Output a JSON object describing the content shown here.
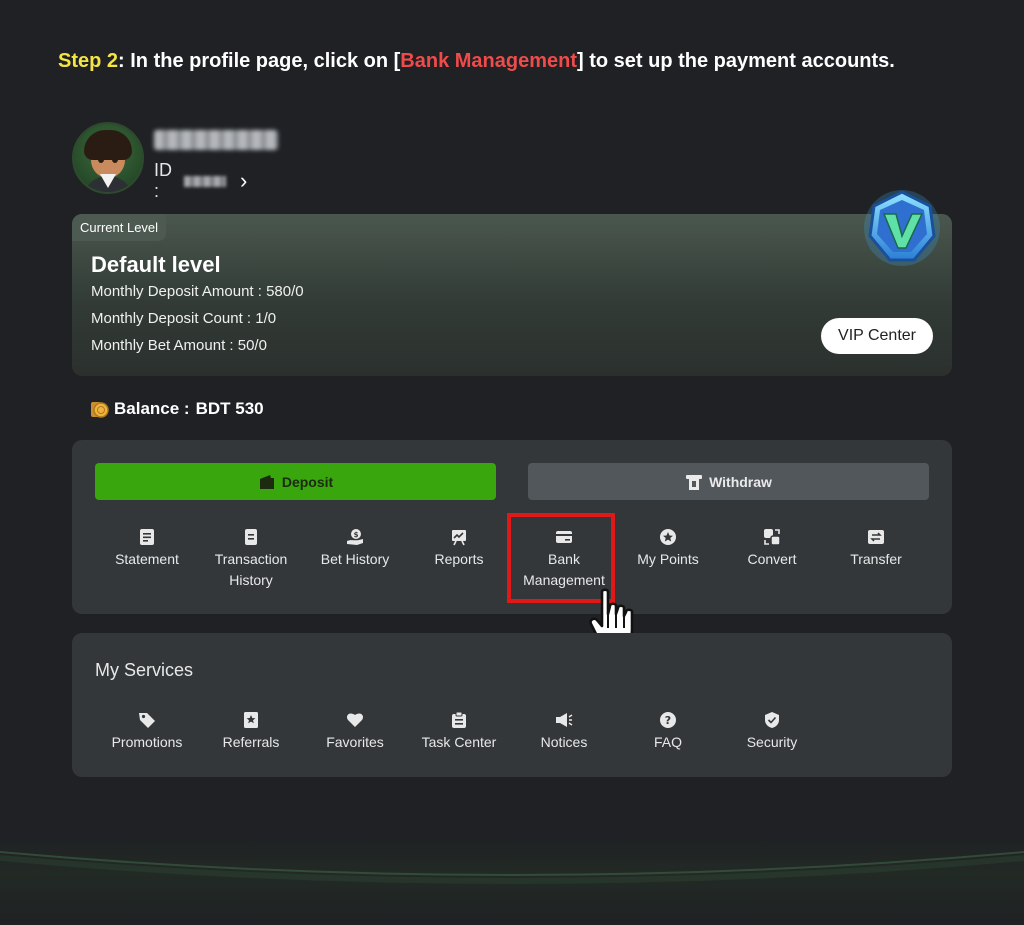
{
  "instruction": {
    "step": "Step 2",
    "text_1": ": In the profile page, click on [",
    "highlight": "Bank Management",
    "text_2": "] to set up the payment accounts."
  },
  "profile": {
    "id_label": "ID :"
  },
  "level_card": {
    "tag": "Current Level",
    "title": "Default level",
    "lines": [
      "Monthly Deposit Amount : 580/0",
      "Monthly Deposit Count : 1/0",
      "Monthly Bet Amount : 50/0"
    ],
    "vip_button": "VIP Center"
  },
  "balance": {
    "label": "Balance :",
    "value": "BDT 530"
  },
  "actions": {
    "deposit": "Deposit",
    "withdraw": "Withdraw"
  },
  "menu": {
    "items": [
      {
        "label": "Statement",
        "icon": "statement-icon"
      },
      {
        "label": "Transaction History",
        "icon": "transaction-history-icon"
      },
      {
        "label": "Bet History",
        "icon": "bet-history-icon"
      },
      {
        "label": "Reports",
        "icon": "reports-icon"
      },
      {
        "label": "Bank Management",
        "icon": "bank-card-icon"
      },
      {
        "label": "My Points",
        "icon": "points-icon"
      },
      {
        "label": "Convert",
        "icon": "convert-icon"
      },
      {
        "label": "Transfer",
        "icon": "transfer-icon"
      }
    ]
  },
  "services": {
    "title": "My Services",
    "items": [
      {
        "label": "Promotions",
        "icon": "tag-icon"
      },
      {
        "label": "Referrals",
        "icon": "bookmark-star-icon"
      },
      {
        "label": "Favorites",
        "icon": "heart-icon"
      },
      {
        "label": "Task Center",
        "icon": "clipboard-icon"
      },
      {
        "label": "Notices",
        "icon": "megaphone-icon"
      },
      {
        "label": "FAQ",
        "icon": "question-icon"
      },
      {
        "label": "Security",
        "icon": "shield-icon"
      }
    ]
  },
  "colors": {
    "background": "#1f2124",
    "step_yellow": "#f4e542",
    "highlight_red": "#ef4b4b",
    "deposit_green": "#3aa60e",
    "box_red": "#e01818"
  }
}
